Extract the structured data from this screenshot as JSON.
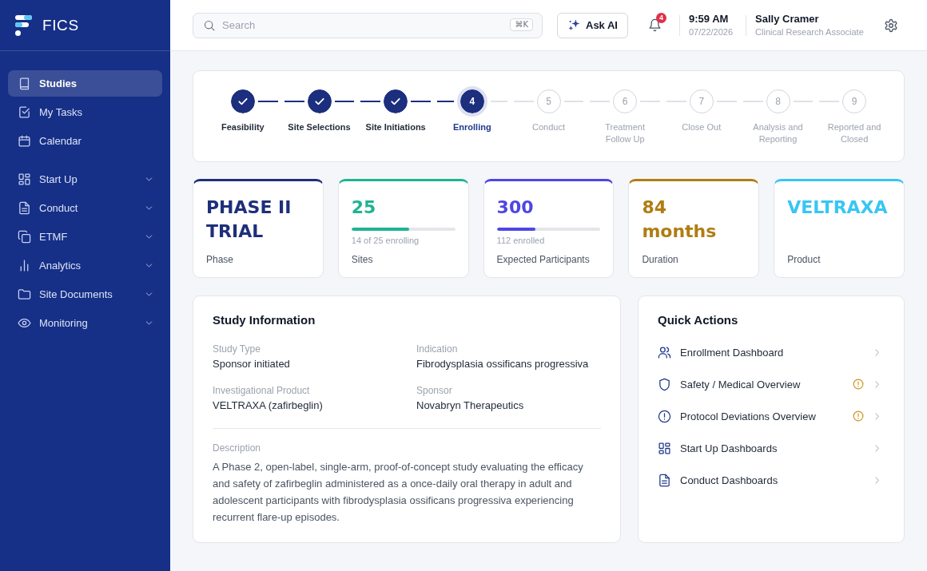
{
  "sidebar": {
    "logo": "FICS",
    "items": [
      {
        "label": "Studies",
        "kind": "link",
        "selected": true
      },
      {
        "label": "My Tasks",
        "kind": "link",
        "selected": false
      },
      {
        "label": "Calendar",
        "kind": "link",
        "selected": false
      },
      {
        "label": "Start Up",
        "kind": "group",
        "selected": false
      },
      {
        "label": "Conduct",
        "kind": "group",
        "selected": false
      },
      {
        "label": "ETMF",
        "kind": "group",
        "selected": false
      },
      {
        "label": "Analytics",
        "kind": "group",
        "selected": false
      },
      {
        "label": "Site Documents",
        "kind": "group",
        "selected": false
      },
      {
        "label": "Monitoring",
        "kind": "group",
        "selected": false
      }
    ]
  },
  "header": {
    "search": {
      "placeholder": "Search",
      "shortcut": "⌘K"
    },
    "ask_ai_button": "Ask AI",
    "notifications": {
      "count": "4"
    },
    "clock": {
      "time": "9:59 AM",
      "date": "07/22/2026"
    },
    "user": {
      "name": "Sally Cramer",
      "role": "Clinical Research Associate"
    }
  },
  "stepper": {
    "steps": [
      {
        "label": "Feasibility",
        "completed": true,
        "current": false
      },
      {
        "label": "Site Selections",
        "completed": true,
        "current": false
      },
      {
        "label": "Site Initiations",
        "completed": true,
        "current": false
      },
      {
        "number": "4",
        "label": "Enrolling",
        "completed": false,
        "current": true
      },
      {
        "number": "5",
        "label": "Conduct",
        "completed": false,
        "current": false
      },
      {
        "number": "6",
        "label": "Treatment Follow Up",
        "completed": false,
        "current": false
      },
      {
        "number": "7",
        "label": "Close Out",
        "completed": false,
        "current": false
      },
      {
        "number": "8",
        "label": "Analysis and Reporting",
        "completed": false,
        "current": false
      },
      {
        "number": "9",
        "label": "Reported and Closed",
        "completed": false,
        "current": false
      }
    ]
  },
  "stats": [
    {
      "kind": "text",
      "value": "PHASE II TRIAL",
      "label": "Phase",
      "color": "#1e2f7a"
    },
    {
      "kind": "progress",
      "value": "25",
      "level": 0.56,
      "caption": "14 of 25 enrolling",
      "label": "Sites",
      "color": "#1fb394"
    },
    {
      "kind": "progress",
      "value": "300",
      "level": 0.37,
      "caption": "112 enrolled",
      "label": "Expected Participants",
      "color": "#4f46e5"
    },
    {
      "kind": "text",
      "value": "84 months",
      "label": "Duration",
      "color": "#b07d12"
    },
    {
      "kind": "text",
      "value": "VELTRAXA",
      "label": "Product",
      "color": "#38c6f4"
    }
  ],
  "study_information": {
    "title": "Study Information",
    "fields": [
      {
        "label": "Study Type",
        "value": "Sponsor initiated"
      },
      {
        "label": "Indication",
        "value": "Fibrodysplasia ossificans progressiva"
      },
      {
        "label": "Investigational Product",
        "value": "VELTRAXA (zafirbeglin)"
      },
      {
        "label": "Sponsor",
        "value": "Novabryn Therapeutics"
      }
    ],
    "description": {
      "label": "Description",
      "text": "A Phase 2, open-label, single-arm, proof-of-concept study evaluating the efficacy and safety of zafirbeglin administered as a once-daily oral therapy in adult and adolescent participants with fibrodysplasia ossificans progressiva experiencing recurrent flare-up episodes."
    }
  },
  "quick_actions": {
    "title": "Quick Actions",
    "items": [
      {
        "label": "Enrollment Dashboard",
        "warning": false
      },
      {
        "label": "Safety / Medical Overview",
        "warning": true
      },
      {
        "label": "Protocol Deviations Overview",
        "warning": true
      },
      {
        "label": "Start Up Dashboards",
        "warning": false
      },
      {
        "label": "Conduct Dashboards",
        "warning": false
      }
    ]
  }
}
